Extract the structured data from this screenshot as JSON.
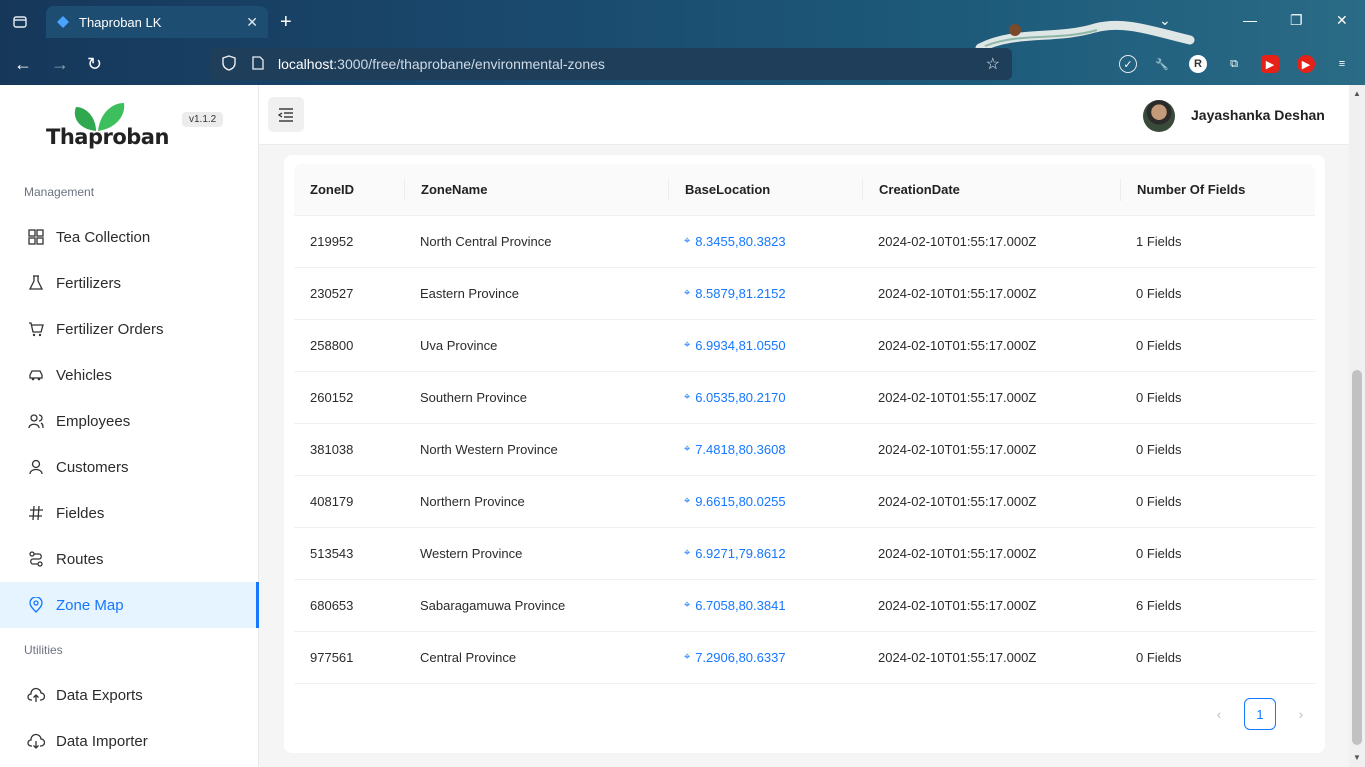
{
  "browser": {
    "tab_title": "Thaproban LK",
    "url_host": "localhost",
    "url_path": ":3000/free/thaprobane/environmental-zones"
  },
  "app": {
    "logo_text": "Thaproban",
    "version": "v1.1.2",
    "user_name": "Jayashanka Deshan"
  },
  "sidebar": {
    "section_management": "Management",
    "section_utilities": "Utilities",
    "items": [
      {
        "label": "Tea Collection",
        "icon": "grid-icon"
      },
      {
        "label": "Fertilizers",
        "icon": "flask-icon"
      },
      {
        "label": "Fertilizer Orders",
        "icon": "cart-icon"
      },
      {
        "label": "Vehicles",
        "icon": "car-icon"
      },
      {
        "label": "Employees",
        "icon": "team-icon"
      },
      {
        "label": "Customers",
        "icon": "user-icon"
      },
      {
        "label": "Fieldes",
        "icon": "hash-icon"
      },
      {
        "label": "Routes",
        "icon": "route-icon"
      },
      {
        "label": "Zone Map",
        "icon": "location-icon",
        "active": true
      }
    ],
    "utilities": [
      {
        "label": "Data Exports",
        "icon": "cloud-upload-icon"
      },
      {
        "label": "Data Importer",
        "icon": "cloud-download-icon"
      }
    ]
  },
  "table": {
    "headers": [
      "ZoneID",
      "ZoneName",
      "BaseLocation",
      "CreationDate",
      "Number Of Fields"
    ],
    "rows": [
      {
        "id": "219952",
        "name": "North Central Province",
        "location": "8.3455,80.3823",
        "date": "2024-02-10T01:55:17.000Z",
        "fields": "1 Fields"
      },
      {
        "id": "230527",
        "name": "Eastern Province",
        "location": "8.5879,81.2152",
        "date": "2024-02-10T01:55:17.000Z",
        "fields": "0 Fields"
      },
      {
        "id": "258800",
        "name": "Uva Province",
        "location": "6.9934,81.0550",
        "date": "2024-02-10T01:55:17.000Z",
        "fields": "0 Fields"
      },
      {
        "id": "260152",
        "name": "Southern Province",
        "location": "6.0535,80.2170",
        "date": "2024-02-10T01:55:17.000Z",
        "fields": "0 Fields"
      },
      {
        "id": "381038",
        "name": "North Western Province",
        "location": "7.4818,80.3608",
        "date": "2024-02-10T01:55:17.000Z",
        "fields": "0 Fields"
      },
      {
        "id": "408179",
        "name": "Northern Province",
        "location": "9.6615,80.0255",
        "date": "2024-02-10T01:55:17.000Z",
        "fields": "0 Fields"
      },
      {
        "id": "513543",
        "name": "Western Province",
        "location": "6.9271,79.8612",
        "date": "2024-02-10T01:55:17.000Z",
        "fields": "0 Fields"
      },
      {
        "id": "680653",
        "name": "Sabaragamuwa Province",
        "location": "6.7058,80.3841",
        "date": "2024-02-10T01:55:17.000Z",
        "fields": "6 Fields"
      },
      {
        "id": "977561",
        "name": "Central Province",
        "location": "7.2906,80.6337",
        "date": "2024-02-10T01:55:17.000Z",
        "fields": "0 Fields"
      }
    ]
  },
  "pagination": {
    "current": "1"
  },
  "colors": {
    "accent": "#1677ff",
    "active_bg": "#e6f4ff"
  }
}
